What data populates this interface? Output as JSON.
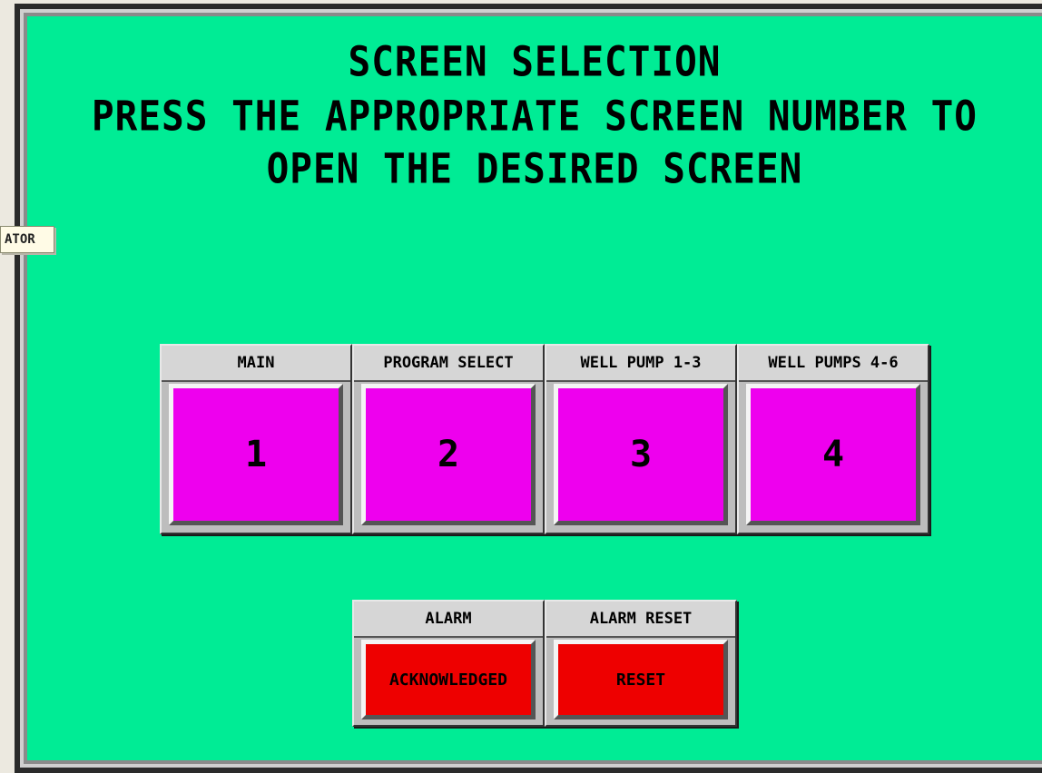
{
  "tooltip": "ATOR",
  "header": {
    "line1": "SCREEN SELECTION",
    "line2": "PRESS THE APPROPRIATE SCREEN NUMBER TO",
    "line3": "OPEN THE DESIRED SCREEN"
  },
  "screens": [
    {
      "label": "MAIN",
      "number": "1"
    },
    {
      "label": "PROGRAM SELECT",
      "number": "2"
    },
    {
      "label": "WELL PUMP 1-3",
      "number": "3"
    },
    {
      "label": "WELL PUMPS 4-6",
      "number": "4"
    }
  ],
  "alarm": {
    "label": "ALARM",
    "button": "ACKNOWLEDGED"
  },
  "alarm_reset": {
    "label": "ALARM RESET",
    "button": "RESET"
  },
  "colors": {
    "background": "#00ec95",
    "screen_button": "#ee00ee",
    "alarm_button": "#ee0000"
  }
}
